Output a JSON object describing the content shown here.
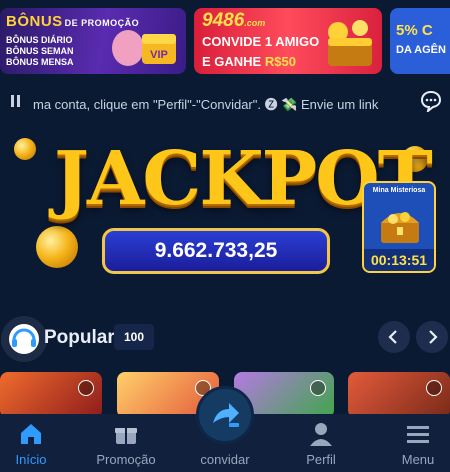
{
  "banners": [
    {
      "title": "BÔNUS",
      "title_suffix": "DE PROMOÇÃO",
      "lines": [
        "BÔNUS DIÁRIO",
        "BÔNUS SEMAN",
        "BÔNUS MENSA"
      ],
      "badge": "VIP"
    },
    {
      "brand": "9486",
      "brand_suffix": ".com",
      "line1": "CONVIDE 1 AMIGO",
      "line2_prefix": "E GANHE ",
      "line2_amount": "R$50"
    },
    {
      "line1": "5% C",
      "line2": "DA AGÊN"
    }
  ],
  "marquee": {
    "text": "ma conta, clique em \"Perfil\"-\"Convidar\". 🅩 💸 Envie um link"
  },
  "jackpot": {
    "title": "JACKPOT",
    "value": "9.662.733,25"
  },
  "mystery_mine": {
    "title": "Mina Misteriosa",
    "timer": "00:13:51"
  },
  "section": {
    "title": "Popular",
    "count": "100"
  },
  "bottom_nav": [
    {
      "label": "Início",
      "icon": "home-icon",
      "active": true
    },
    {
      "label": "Promoção",
      "icon": "gift-icon",
      "active": false
    },
    {
      "label": "convidar",
      "icon": "share-icon",
      "active": false
    },
    {
      "label": "Perfil",
      "icon": "user-icon",
      "active": false
    },
    {
      "label": "Menu",
      "icon": "menu-icon",
      "active": false
    }
  ],
  "colors": {
    "background": "#0b1a33",
    "accent": "#2f9bff",
    "gold": "#ffc61a"
  }
}
